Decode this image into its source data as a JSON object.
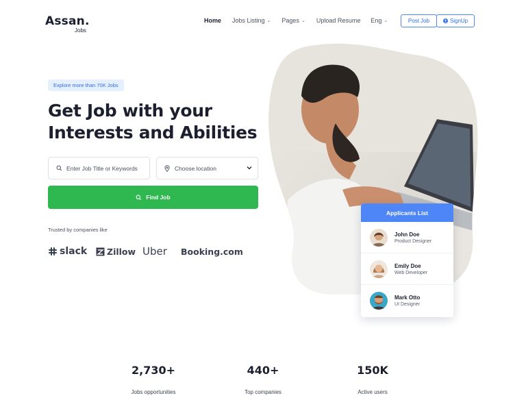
{
  "header": {
    "logo": "Assan.",
    "logo_sub": "Jobs",
    "nav": [
      {
        "label": "Home",
        "dropdown": false
      },
      {
        "label": "Jobs Listing",
        "dropdown": true
      },
      {
        "label": "Pages",
        "dropdown": true
      },
      {
        "label": "Upload Resume",
        "dropdown": false
      },
      {
        "label": "Eng",
        "dropdown": true
      }
    ],
    "post_job": "Post Job",
    "signup": "SignUp"
  },
  "hero": {
    "badge": "Explore more than 70K Jobs",
    "headline_line1": "Get Job with your",
    "headline_line2": "Interests and Abilities",
    "search_placeholder": "Enter Job Title or Keywords",
    "location_placeholder": "Choose location",
    "find_button": "Find Job",
    "trusted_label": "Trusted by companies like",
    "brands": [
      "slack",
      "Zillow",
      "Uber",
      "Booking.com"
    ]
  },
  "applicants": {
    "title": "Applicants List",
    "list": [
      {
        "name": "John Doe",
        "role": "Product Designer"
      },
      {
        "name": "Emily Doe",
        "role": "Web Developer"
      },
      {
        "name": "Mark Otto",
        "role": "UI Designer"
      }
    ]
  },
  "stats": [
    {
      "value": "2,730+",
      "label": "Jobs opportunities"
    },
    {
      "value": "440+",
      "label": "Top companies"
    },
    {
      "value": "150K",
      "label": "Active users"
    }
  ],
  "colors": {
    "primary_blue": "#4f86f7",
    "find_green": "#2fb84f",
    "badge_bg": "#e6effe",
    "text_dark": "#1b1f2e"
  },
  "icons": {
    "search": "search-icon",
    "location": "location-pin-icon",
    "user": "user-icon",
    "chevron": "chevron-down-icon"
  }
}
